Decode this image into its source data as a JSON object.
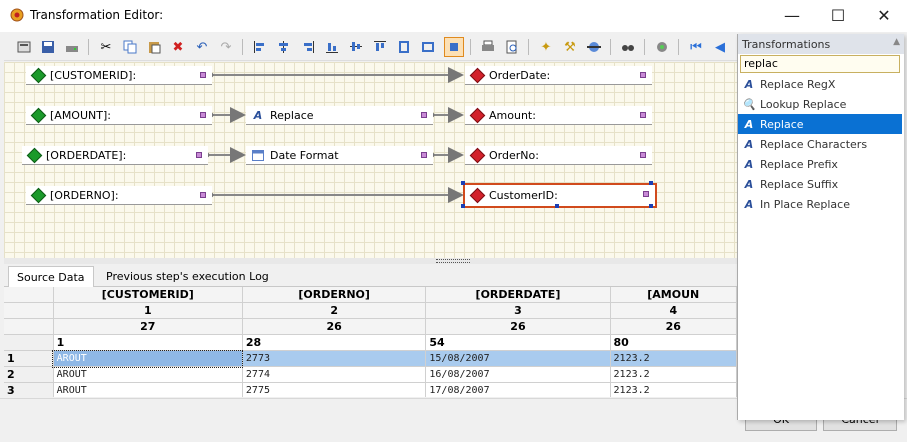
{
  "window": {
    "title": "Transformation Editor:",
    "min": "—",
    "max": "☐",
    "close": "✕"
  },
  "canvas": {
    "nodes": [
      {
        "id": "src-customerid",
        "label": "[CUSTOMERID]:",
        "kind": "source"
      },
      {
        "id": "src-amount",
        "label": "[AMOUNT]:",
        "kind": "source"
      },
      {
        "id": "src-orderdate",
        "label": "[ORDERDATE]:",
        "kind": "source"
      },
      {
        "id": "src-orderno",
        "label": "[ORDERNO]:",
        "kind": "source"
      },
      {
        "id": "fn-replace",
        "label": "Replace",
        "kind": "function"
      },
      {
        "id": "fn-dateformat",
        "label": "Date Format",
        "kind": "function"
      },
      {
        "id": "dst-orderdate",
        "label": "OrderDate:",
        "kind": "target"
      },
      {
        "id": "dst-amount",
        "label": "Amount:",
        "kind": "target"
      },
      {
        "id": "dst-orderno",
        "label": "OrderNo:",
        "kind": "target"
      },
      {
        "id": "dst-customerid",
        "label": "CustomerID:",
        "kind": "target"
      }
    ]
  },
  "tabs": [
    {
      "label": "Source Data"
    },
    {
      "label": "Previous step's execution Log"
    }
  ],
  "grid": {
    "headers": [
      "[CUSTOMERID]",
      "[ORDERNO]",
      "[ORDERDATE]",
      "[AMOUN"
    ],
    "indexes": [
      "1",
      "2",
      "3",
      "4"
    ],
    "widths": [
      "27",
      "26",
      "26",
      "26"
    ],
    "offsets": [
      "1",
      "28",
      "54",
      "80"
    ],
    "rows": [
      {
        "num": "1",
        "cells": [
          "AROUT",
          "2773",
          "15/08/2007",
          "2123.2"
        ]
      },
      {
        "num": "2",
        "cells": [
          "AROUT",
          "2774",
          "16/08/2007",
          "2123.2"
        ]
      },
      {
        "num": "3",
        "cells": [
          "AROUT",
          "2775",
          "17/08/2007",
          "2123.2"
        ]
      }
    ]
  },
  "buttons": {
    "ok": "OK",
    "cancel": "Cancel"
  },
  "transformations": {
    "title": "Transformations",
    "search_value": "replac",
    "items": [
      {
        "label": "Replace RegX",
        "icon": "A"
      },
      {
        "label": "Lookup Replace",
        "icon": "🔍"
      },
      {
        "label": "Replace",
        "icon": "A"
      },
      {
        "label": "Replace Characters",
        "icon": "A"
      },
      {
        "label": "Replace Prefix",
        "icon": "A"
      },
      {
        "label": "Replace Suffix",
        "icon": "A"
      },
      {
        "label": "In Place Replace",
        "icon": "A"
      }
    ]
  },
  "colors": {
    "accent": "#0a71d3",
    "selection_border": "#d14a1c",
    "canvas_bg": "#fbf9ec",
    "source_icon": "#1a9a2a",
    "target_icon": "#d2202a"
  }
}
